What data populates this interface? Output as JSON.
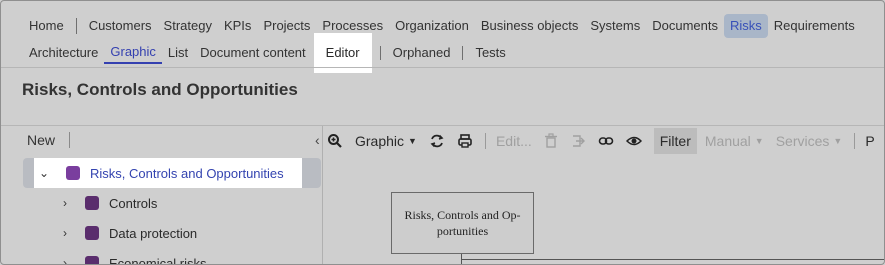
{
  "nav_primary": {
    "items": [
      "Home",
      "Customers",
      "Strategy",
      "KPIs",
      "Projects",
      "Processes",
      "Organization",
      "Business objects",
      "Systems",
      "Documents",
      "Risks",
      "Requirements"
    ],
    "active": "Risks"
  },
  "nav_secondary": {
    "items": [
      "Architecture",
      "Graphic",
      "List",
      "Document content",
      "Editor",
      "Orphaned",
      "Tests"
    ],
    "active": "Graphic",
    "highlighted": "Editor"
  },
  "page": {
    "title": "Risks, Controls and Opportunities"
  },
  "left_pane": {
    "new_label": "New",
    "tree": [
      {
        "label": "Risks, Controls and Opportunities",
        "expanded": true,
        "selected": true,
        "color": "#7a3e9e"
      },
      {
        "label": "Controls",
        "expanded": false,
        "color": "#5a2d6d"
      },
      {
        "label": "Data protection",
        "expanded": false,
        "color": "#5a2d6d"
      },
      {
        "label": "Economical risks",
        "expanded": false,
        "color": "#5a2d6d"
      }
    ]
  },
  "toolbar": {
    "view_label": "Graphic",
    "edit_label": "Edit...",
    "filter_label": "Filter",
    "manual_label": "Manual",
    "services_label": "Services",
    "cut_label": "P"
  },
  "diagram": {
    "node_label": "Risks, Controls and Op-portunities"
  },
  "colors": {
    "accent": "#3444b0",
    "highlight": "#ffffff",
    "selected_tab_bg": "#a9b6c8"
  }
}
